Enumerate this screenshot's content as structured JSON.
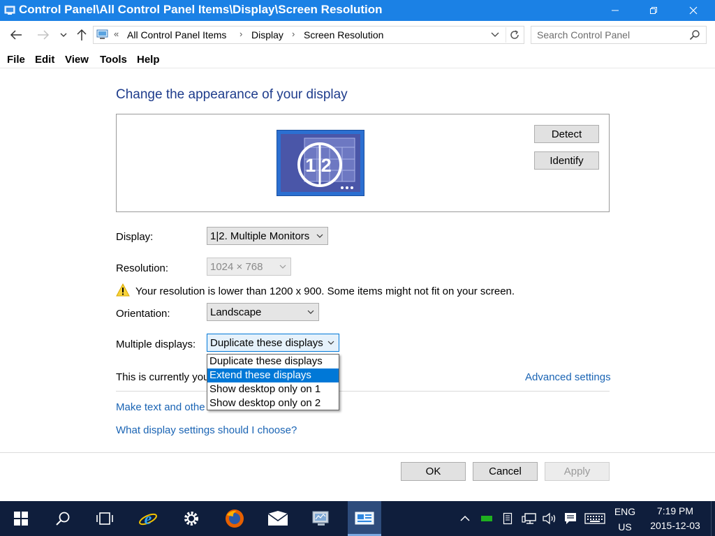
{
  "window": {
    "title": "Control Panel\\All Control Panel Items\\Display\\Screen Resolution"
  },
  "address": {
    "crumbs": [
      "All Control Panel Items",
      "Display",
      "Screen Resolution"
    ],
    "prefix": "«"
  },
  "search": {
    "placeholder": "Search Control Panel"
  },
  "menu": [
    "File",
    "Edit",
    "View",
    "Tools",
    "Help"
  ],
  "content": {
    "heading": "Change the appearance of your display",
    "monitor_label": "1 2",
    "detect_label": "Detect",
    "identify_label": "Identify",
    "display_label": "Display:",
    "display_value": "1|2. Multiple Monitors",
    "resolution_label": "Resolution:",
    "resolution_value": "1024 × 768",
    "warning_text": "Your resolution is lower than 1200 x 900. Some items might not fit on your screen.",
    "orientation_label": "Orientation:",
    "orientation_value": "Landscape",
    "multiple_label": "Multiple displays:",
    "multiple_value": "Duplicate these displays",
    "current_text": "This is currently you",
    "advanced_link": "Advanced settings",
    "make_text_link": "Make text and othe",
    "what_settings_link": "What display settings should I choose?"
  },
  "dropdown": {
    "options": [
      "Duplicate these displays",
      "Extend these displays",
      "Show desktop only on 1",
      "Show desktop only on 2"
    ],
    "selected_index": 1
  },
  "buttons": {
    "ok": "OK",
    "cancel": "Cancel",
    "apply": "Apply"
  },
  "taskbar": {
    "lang_top": "ENG",
    "lang_bottom": "US",
    "time": "7:19 PM",
    "date": "2015-12-03"
  },
  "colors": {
    "titlebar": "#1b81e5",
    "heading": "#1e3c8c",
    "link": "#1a64b4",
    "selection": "#0078d7",
    "taskbar": "#0f1e3c"
  }
}
